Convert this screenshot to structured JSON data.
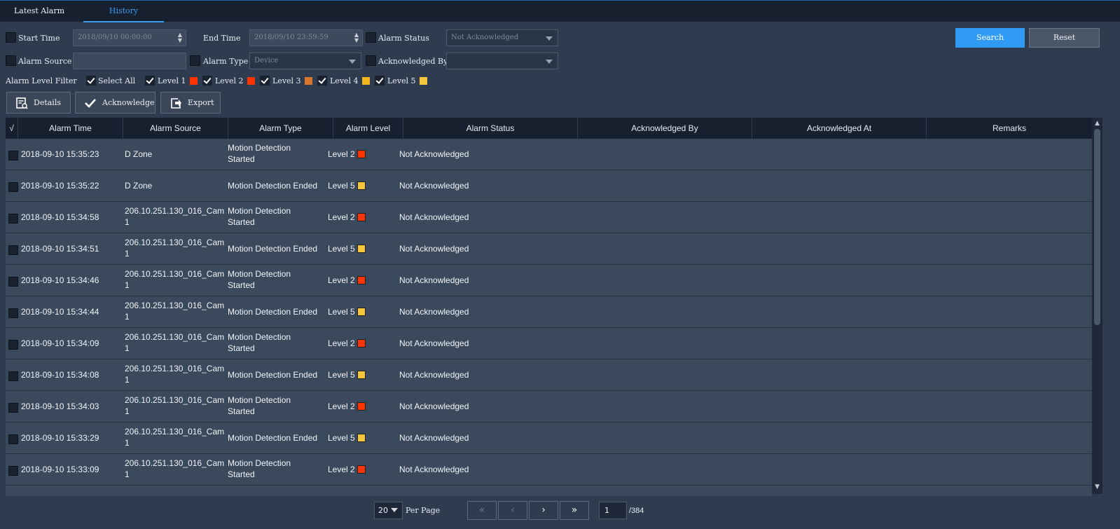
{
  "tabs": [
    "Latest Alarm",
    "History"
  ],
  "filters": {
    "start_time_label": "Start Time",
    "start_time_value": "2018/09/10 00:00:00",
    "end_time_label": "End Time",
    "end_time_value": "2018/09/10 23:59:59",
    "alarm_status_label": "Alarm Status",
    "alarm_status_value": "Not Acknowledged",
    "alarm_source_label": "Alarm Source",
    "alarm_source_value": "",
    "alarm_type_label": "Alarm Type",
    "alarm_type_value": "Device",
    "acknowledged_by_label": "Acknowledged By",
    "acknowledged_by_value": "",
    "search_label": "Search",
    "reset_label": "Reset"
  },
  "level_filter": {
    "label": "Alarm Level Filter",
    "select_all": "Select All",
    "levels": [
      {
        "label": "Level 1",
        "color": "#ff3300"
      },
      {
        "label": "Level 2",
        "color": "#ff3300"
      },
      {
        "label": "Level 3",
        "color": "#d9762b"
      },
      {
        "label": "Level 4",
        "color": "#f5b41b"
      },
      {
        "label": "Level 5",
        "color": "#f5c53a"
      }
    ]
  },
  "toolbar": {
    "details": "Details",
    "acknowledge": "Acknowledge",
    "export": "Export"
  },
  "table": {
    "check_header": "√",
    "columns": [
      "Alarm Time",
      "Alarm Source",
      "Alarm Type",
      "Alarm Level",
      "Alarm Status",
      "Acknowledged By",
      "Acknowledged At",
      "Remarks"
    ],
    "rows": [
      {
        "time": "2018-09-10 15:35:23",
        "source": [
          "D Zone"
        ],
        "type": [
          "Motion Detection",
          "Started"
        ],
        "level": "Level 2",
        "color": "#ff3300",
        "status": "Not Acknowledged"
      },
      {
        "time": "2018-09-10 15:35:22",
        "source": [
          "D Zone"
        ],
        "type": [
          "Motion Detection Ended"
        ],
        "level": "Level 5",
        "color": "#f5c53a",
        "status": "Not Acknowledged"
      },
      {
        "time": "2018-09-10 15:34:58",
        "source": [
          "206.10.251.130_016_Cam",
          "1"
        ],
        "type": [
          "Motion Detection",
          "Started"
        ],
        "level": "Level 2",
        "color": "#ff3300",
        "status": "Not Acknowledged"
      },
      {
        "time": "2018-09-10 15:34:51",
        "source": [
          "206.10.251.130_016_Cam",
          "1"
        ],
        "type": [
          "Motion Detection Ended"
        ],
        "level": "Level 5",
        "color": "#f5c53a",
        "status": "Not Acknowledged"
      },
      {
        "time": "2018-09-10 15:34:46",
        "source": [
          "206.10.251.130_016_Cam",
          "1"
        ],
        "type": [
          "Motion Detection",
          "Started"
        ],
        "level": "Level 2",
        "color": "#ff3300",
        "status": "Not Acknowledged"
      },
      {
        "time": "2018-09-10 15:34:44",
        "source": [
          "206.10.251.130_016_Cam",
          "1"
        ],
        "type": [
          "Motion Detection Ended"
        ],
        "level": "Level 5",
        "color": "#f5c53a",
        "status": "Not Acknowledged"
      },
      {
        "time": "2018-09-10 15:34:09",
        "source": [
          "206.10.251.130_016_Cam",
          "1"
        ],
        "type": [
          "Motion Detection",
          "Started"
        ],
        "level": "Level 2",
        "color": "#ff3300",
        "status": "Not Acknowledged"
      },
      {
        "time": "2018-09-10 15:34:08",
        "source": [
          "206.10.251.130_016_Cam",
          "1"
        ],
        "type": [
          "Motion Detection Ended"
        ],
        "level": "Level 5",
        "color": "#f5c53a",
        "status": "Not Acknowledged"
      },
      {
        "time": "2018-09-10 15:34:03",
        "source": [
          "206.10.251.130_016_Cam",
          "1"
        ],
        "type": [
          "Motion Detection",
          "Started"
        ],
        "level": "Level 2",
        "color": "#ff3300",
        "status": "Not Acknowledged"
      },
      {
        "time": "2018-09-10 15:33:29",
        "source": [
          "206.10.251.130_016_Cam",
          "1"
        ],
        "type": [
          "Motion Detection Ended"
        ],
        "level": "Level 5",
        "color": "#f5c53a",
        "status": "Not Acknowledged"
      },
      {
        "time": "2018-09-10 15:33:09",
        "source": [
          "206.10.251.130_016_Cam",
          "1"
        ],
        "type": [
          "Motion Detection",
          "Started"
        ],
        "level": "Level 2",
        "color": "#ff3300",
        "status": "Not Acknowledged"
      }
    ]
  },
  "pagination": {
    "per_page": "20",
    "per_page_label": "Per Page",
    "current_page": "1",
    "total_pages": "/384"
  }
}
